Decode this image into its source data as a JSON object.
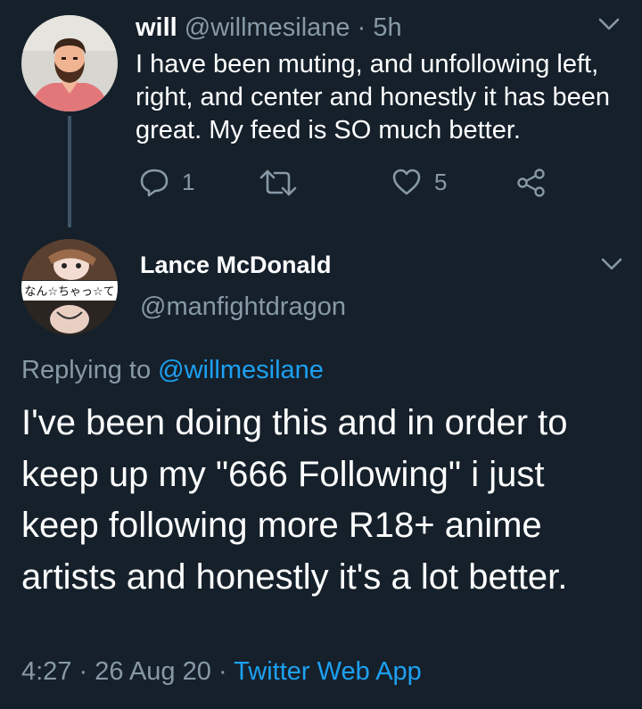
{
  "reply_tweet": {
    "name": "will",
    "handle": "@willmesilane",
    "separator": "·",
    "time": "5h",
    "text": "I have been muting, and unfollowing left, right, and center and honestly it has been great. My feed is SO much better.",
    "actions": {
      "reply_count": "1",
      "retweet_count": "",
      "like_count": "5"
    }
  },
  "main_tweet": {
    "name": "Lance McDonald",
    "handle": "@manfightdragon",
    "replying_to_prefix": "Replying to",
    "replying_to_handle": "@willmesilane",
    "text": "I've been doing this and in order to keep up my \"666 Following\" i just keep following more R18+ anime artists and honestly it's a lot better.",
    "avatar_caption": "なん☆ちゃっ☆て",
    "time": "4:27",
    "separator": "·",
    "date": "26 Aug 20",
    "source": "Twitter Web App"
  },
  "colors": {
    "background": "#15202b",
    "primary_text": "#ffffff",
    "secondary_text": "#8899a6",
    "link": "#1da1f2",
    "thread_line": "#3d5466"
  },
  "icons": [
    "chevron-down-icon",
    "reply-icon",
    "retweet-icon",
    "like-icon",
    "share-icon"
  ]
}
